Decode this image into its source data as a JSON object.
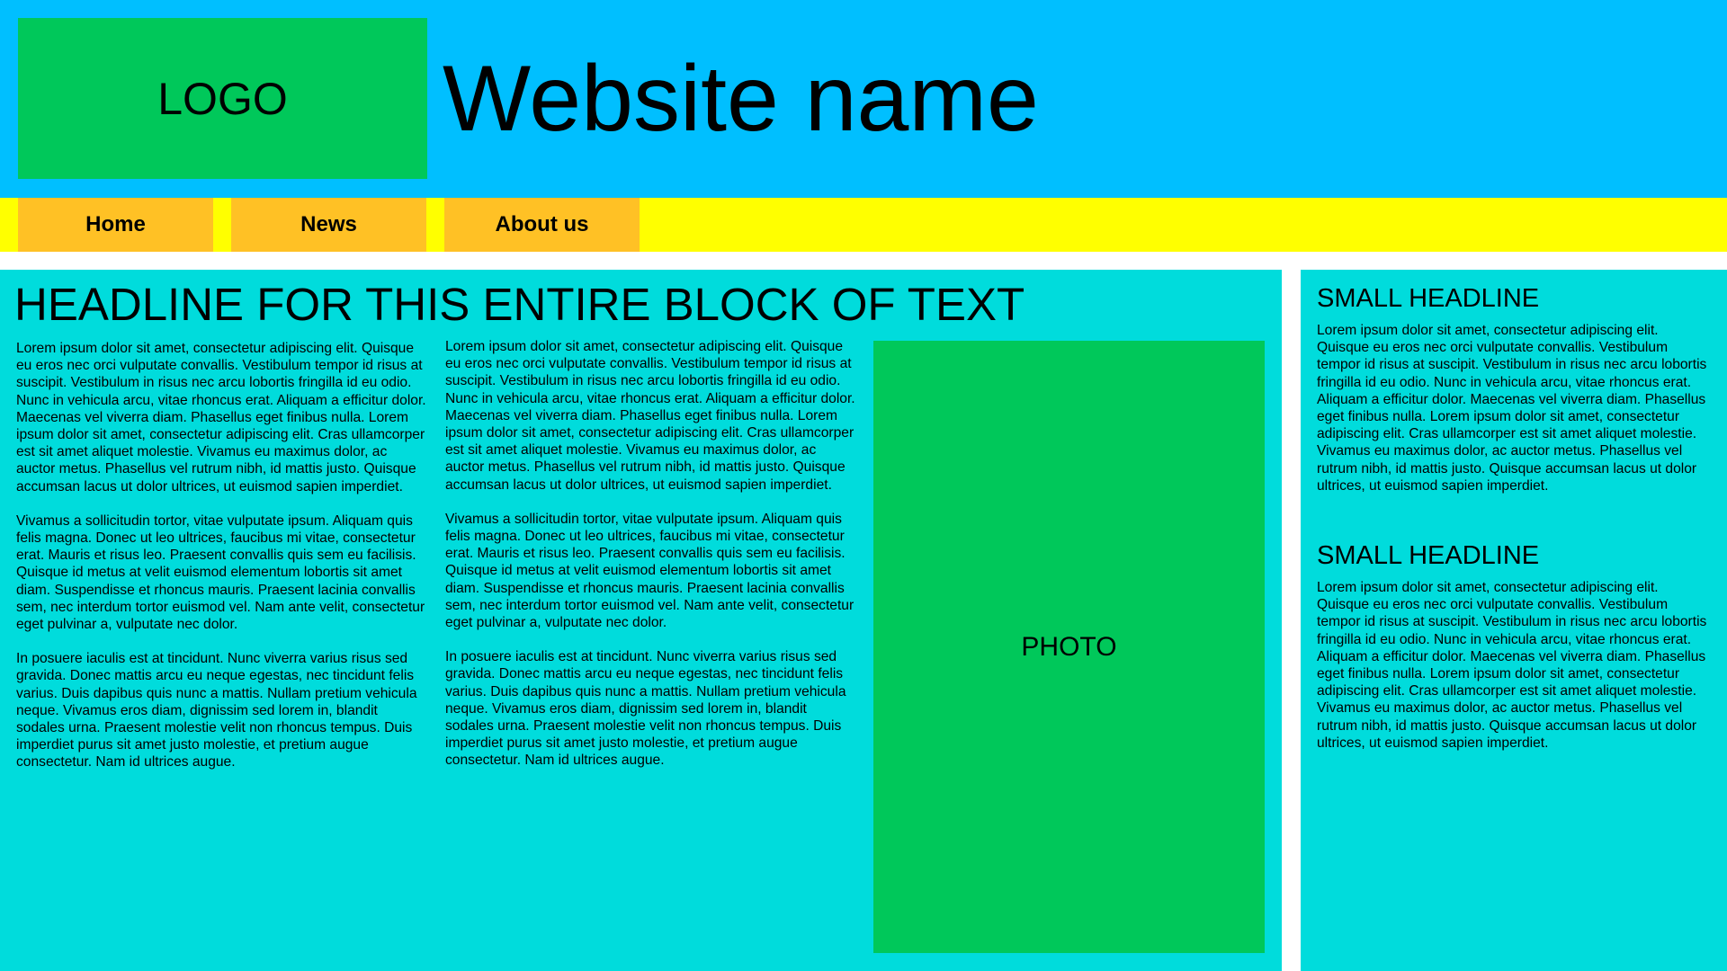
{
  "header": {
    "logo_text": "LOGO",
    "site_name": "Website name"
  },
  "nav": {
    "items": [
      {
        "label": "Home"
      },
      {
        "label": "News"
      },
      {
        "label": "About us"
      }
    ]
  },
  "main": {
    "headline": "HEADLINE FOR THIS ENTIRE BLOCK OF TEXT",
    "columns": [
      {
        "paragraphs": [
          "Lorem ipsum dolor sit amet, consectetur adipiscing elit. Quisque eu eros nec orci vulputate convallis. Vestibulum tempor id risus at suscipit. Vestibulum in risus nec arcu lobortis fringilla id eu odio. Nunc in vehicula arcu, vitae rhoncus erat. Aliquam a efficitur dolor. Maecenas vel viverra diam. Phasellus eget finibus nulla. Lorem ipsum dolor sit amet, consectetur adipiscing elit. Cras ullamcorper est sit amet aliquet molestie. Vivamus eu maximus dolor, ac auctor metus. Phasellus vel rutrum nibh, id mattis justo. Quisque accumsan lacus ut dolor ultrices, ut euismod sapien imperdiet.",
          "Vivamus a sollicitudin tortor, vitae vulputate ipsum. Aliquam quis felis magna. Donec ut leo ultrices, faucibus mi vitae, consectetur erat. Mauris et risus leo. Praesent convallis quis sem eu facilisis. Quisque id metus at velit euismod elementum lobortis sit amet diam. Suspendisse et rhoncus mauris. Praesent lacinia convallis sem, nec interdum tortor euismod vel. Nam ante velit, consectetur eget pulvinar a, vulputate nec dolor.",
          "In posuere iaculis est at tincidunt. Nunc viverra varius risus sed gravida. Donec mattis arcu eu neque egestas, nec tincidunt felis varius. Duis dapibus quis nunc a mattis. Nullam pretium vehicula neque. Vivamus eros diam, dignissim sed lorem in, blandit sodales urna. Praesent molestie velit non rhoncus tempus. Duis imperdiet purus sit amet justo molestie, et pretium augue consectetur. Nam id ultrices augue."
        ]
      },
      {
        "paragraphs": [
          "Lorem ipsum dolor sit amet, consectetur adipiscing elit. Quisque eu eros nec orci vulputate convallis. Vestibulum tempor id risus at suscipit. Vestibulum in risus nec arcu lobortis fringilla id eu odio. Nunc in vehicula arcu, vitae rhoncus erat. Aliquam a efficitur dolor. Maecenas vel viverra diam. Phasellus eget finibus nulla. Lorem ipsum dolor sit amet, consectetur adipiscing elit. Cras ullamcorper est sit amet aliquet molestie. Vivamus eu maximus dolor, ac auctor metus. Phasellus vel rutrum nibh, id mattis justo. Quisque accumsan lacus ut dolor ultrices, ut euismod sapien imperdiet.",
          "Vivamus a sollicitudin tortor, vitae vulputate ipsum. Aliquam quis felis magna. Donec ut leo ultrices, faucibus mi vitae, consectetur erat. Mauris et risus leo. Praesent convallis quis sem eu facilisis. Quisque id metus at velit euismod elementum lobortis sit amet diam. Suspendisse et rhoncus mauris. Praesent lacinia convallis sem, nec interdum tortor euismod vel. Nam ante velit, consectetur eget pulvinar a, vulputate nec dolor.",
          "In posuere iaculis est at tincidunt. Nunc viverra varius risus sed gravida. Donec mattis arcu eu neque egestas, nec tincidunt felis varius. Duis dapibus quis nunc a mattis. Nullam pretium vehicula neque. Vivamus eros diam, dignissim sed lorem in, blandit sodales urna. Praesent molestie velit non rhoncus tempus. Duis imperdiet purus sit amet justo molestie, et pretium augue consectetur. Nam id ultrices augue."
        ]
      }
    ],
    "photo_label": "PHOTO"
  },
  "sidebar": {
    "blocks": [
      {
        "headline": "SMALL HEADLINE",
        "text": "Lorem ipsum dolor sit amet, consectetur adipiscing elit. Quisque eu eros nec orci vulputate convallis. Vestibulum tempor id risus at suscipit. Vestibulum in risus nec arcu lobortis fringilla id eu odio. Nunc in vehicula arcu, vitae rhoncus erat. Aliquam a efficitur dolor. Maecenas vel viverra diam. Phasellus eget finibus nulla. Lorem ipsum dolor sit amet, consectetur adipiscing elit. Cras ullamcorper est sit amet aliquet molestie. Vivamus eu maximus dolor, ac auctor metus. Phasellus vel rutrum nibh, id mattis justo. Quisque accumsan lacus ut dolor ultrices, ut euismod sapien imperdiet."
      },
      {
        "headline": "SMALL HEADLINE",
        "text": "Lorem ipsum dolor sit amet, consectetur adipiscing elit. Quisque eu eros nec orci vulputate convallis. Vestibulum tempor id risus at suscipit. Vestibulum in risus nec arcu lobortis fringilla id eu odio. Nunc in vehicula arcu, vitae rhoncus erat. Aliquam a efficitur dolor. Maecenas vel viverra diam. Phasellus eget finibus nulla. Lorem ipsum dolor sit amet, consectetur adipiscing elit. Cras ullamcorper est sit amet aliquet molestie. Vivamus eu maximus dolor, ac auctor metus. Phasellus vel rutrum nibh, id mattis justo. Quisque accumsan lacus ut dolor ultrices, ut euismod sapien imperdiet."
      }
    ]
  },
  "colors": {
    "header_bg": "#00bfff",
    "logo_bg": "#00c85a",
    "navbar_bg": "#ffff00",
    "nav_item_bg": "#ffc125",
    "content_bg": "#00dcdc",
    "photo_bg": "#00c85a"
  }
}
